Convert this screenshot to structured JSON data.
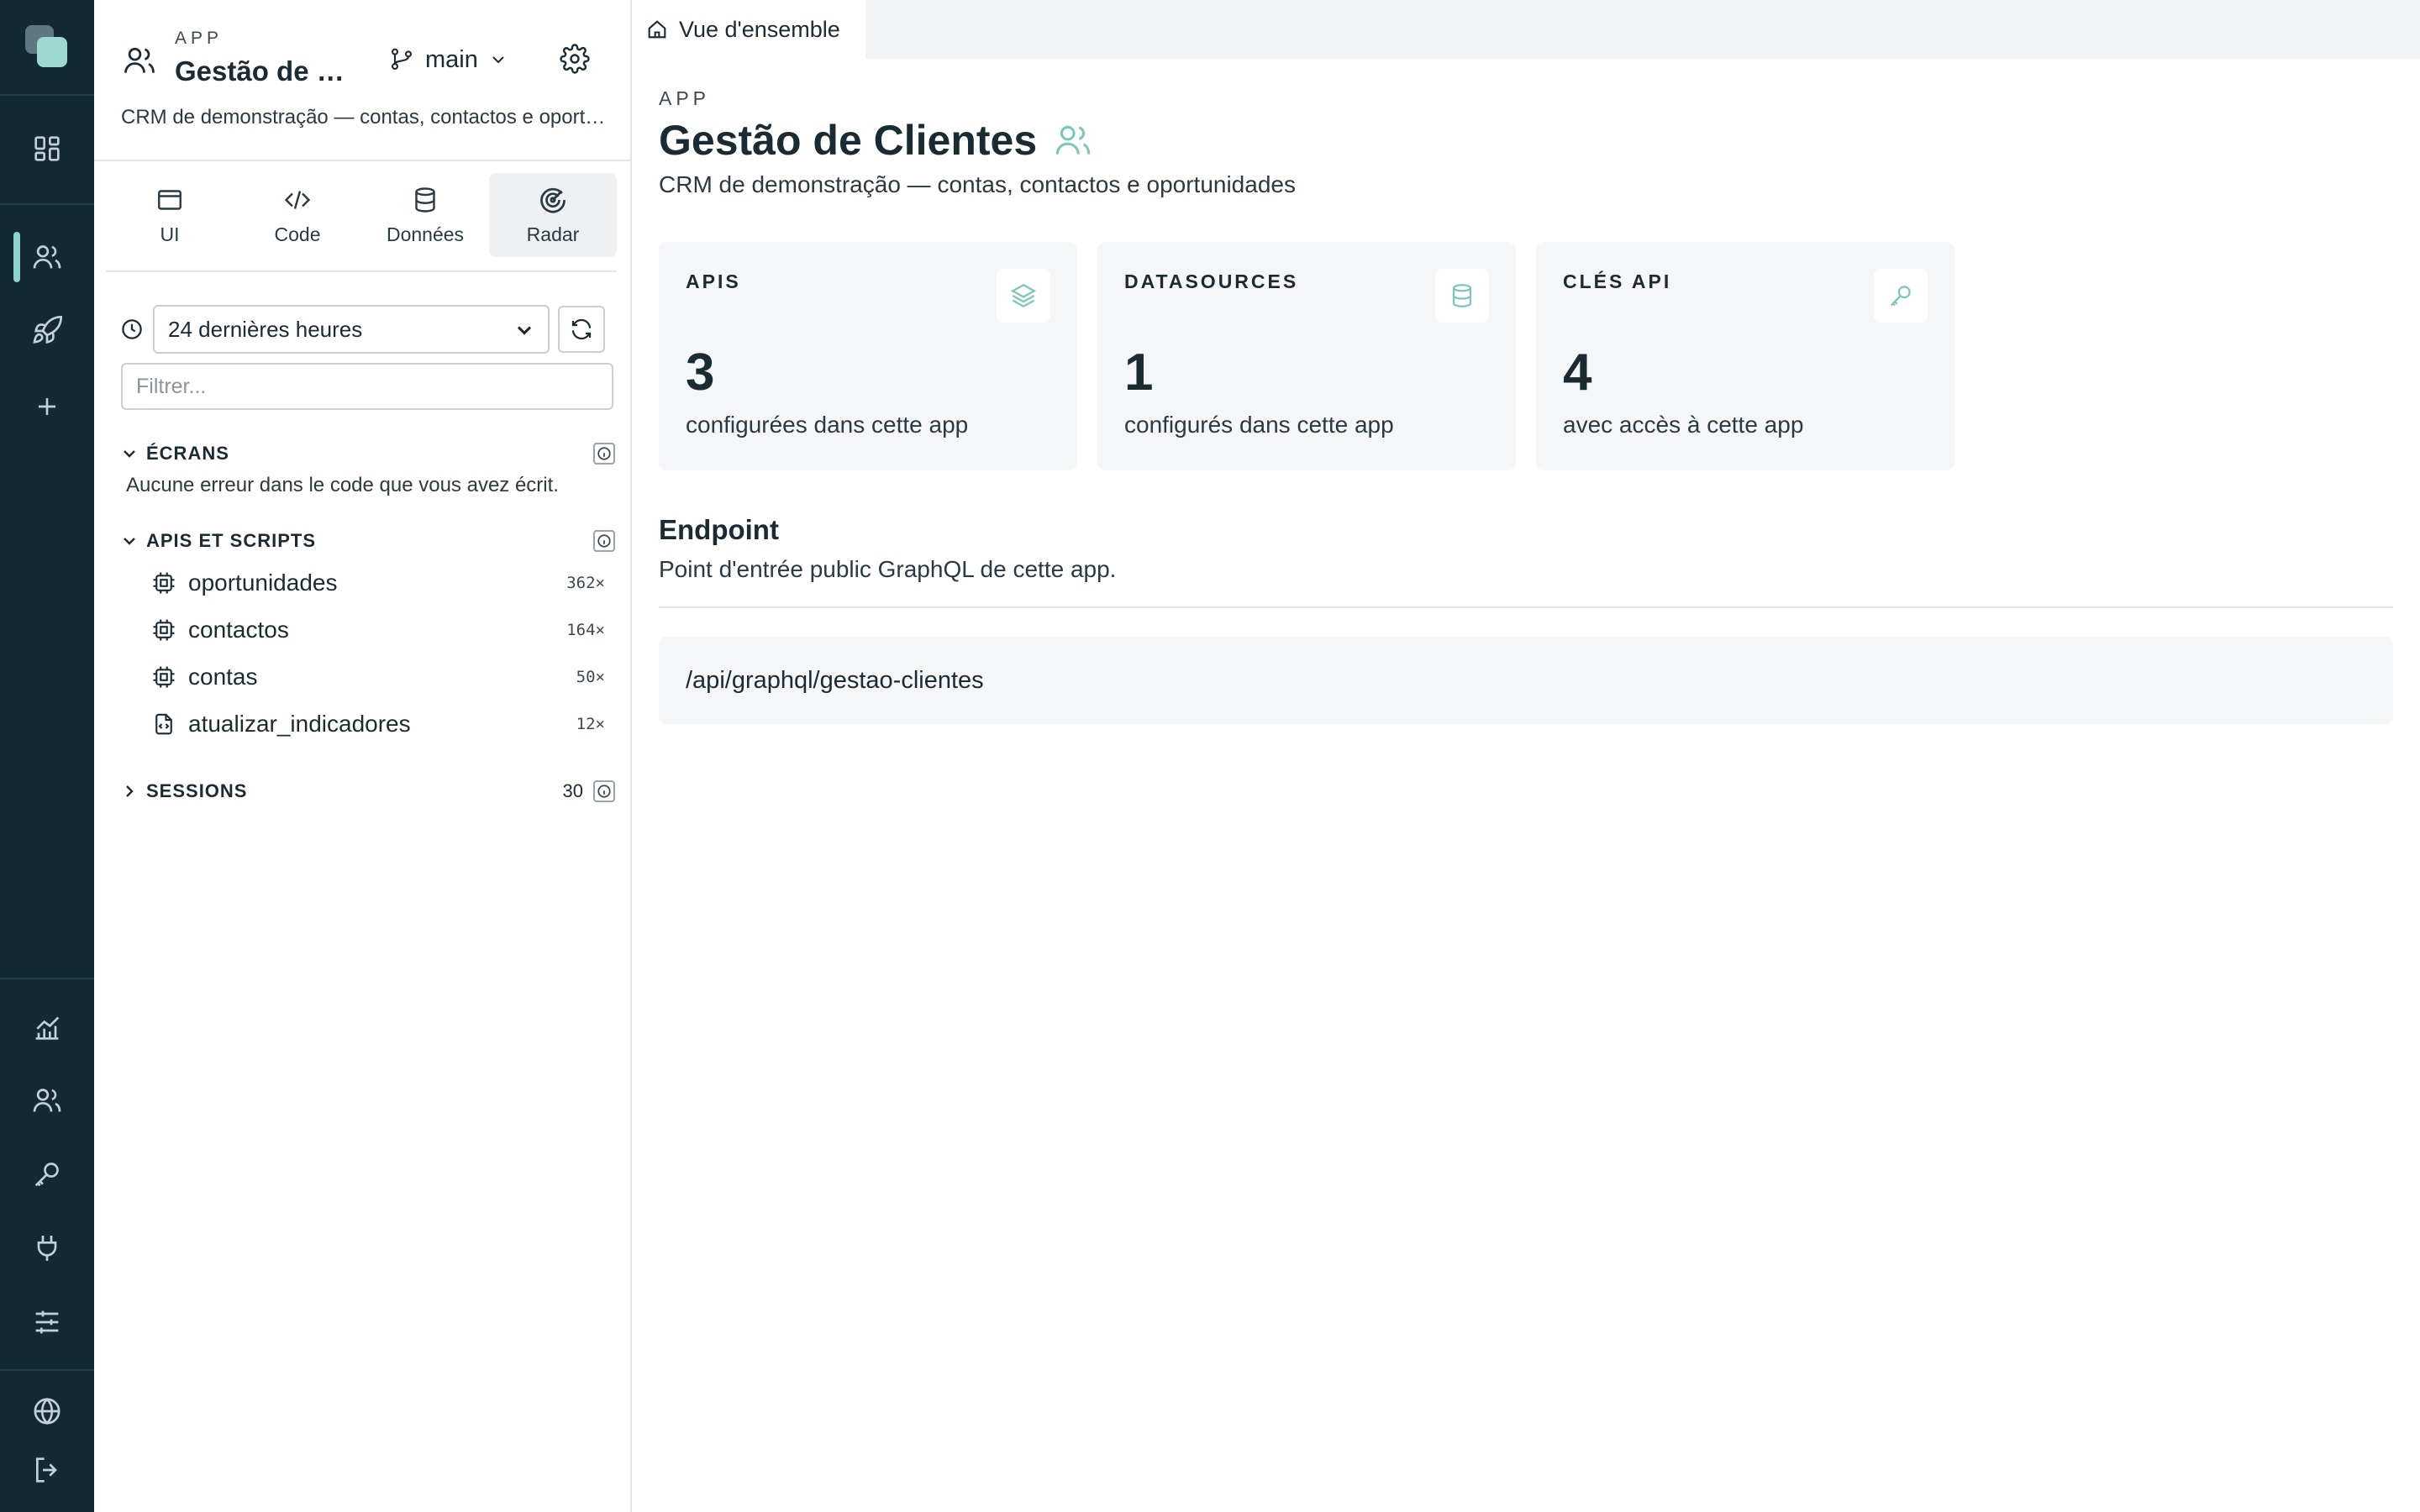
{
  "colors": {
    "rail_bg": "#132a33",
    "accent": "#7cc7ba",
    "card_bg": "#f5f6f7"
  },
  "app_panel": {
    "kicker": "APP",
    "title": "Gestão de Clientes",
    "branch": "main",
    "description": "CRM de demonstração — contas, contactos e oportunidades",
    "tabs": [
      {
        "label": "UI",
        "icon": "browser-window-icon"
      },
      {
        "label": "Code",
        "icon": "code-icon"
      },
      {
        "label": "Données",
        "icon": "database-icon"
      },
      {
        "label": "Radar",
        "icon": "radar-icon",
        "active": true
      }
    ],
    "time_range": "24 dernières heures",
    "filter_placeholder": "Filtrer...",
    "screens": {
      "title": "ÉCRANS",
      "note": "Aucune erreur dans le code que vous avez écrit."
    },
    "apis": {
      "title": "APIS ET SCRIPTS",
      "items": [
        {
          "name": "oportunidades",
          "count": "362×",
          "icon": "chip-icon"
        },
        {
          "name": "contactos",
          "count": "164×",
          "icon": "chip-icon"
        },
        {
          "name": "contas",
          "count": "50×",
          "icon": "chip-icon"
        },
        {
          "name": "atualizar_indicadores",
          "count": "12×",
          "icon": "script-file-icon"
        }
      ]
    },
    "sessions": {
      "title": "SESSIONS",
      "count": "30"
    }
  },
  "main": {
    "tab_label": "Vue d'ensemble",
    "kicker": "APP",
    "title": "Gestão de Clientes",
    "subtitle": "CRM de demonstração — contas, contactos e oportunidades",
    "cards": [
      {
        "label": "APIS",
        "value": "3",
        "caption": "configurées dans cette app",
        "icon": "layers-icon"
      },
      {
        "label": "DATASOURCES",
        "value": "1",
        "caption": "configurés dans cette app",
        "icon": "database-icon"
      },
      {
        "label": "CLÉS API",
        "value": "4",
        "caption": "avec accès à cette app",
        "icon": "key-icon"
      }
    ],
    "endpoint": {
      "title": "Endpoint",
      "subtitle": "Point d'entrée public GraphQL de cette app.",
      "path": "/api/graphql/gestao-clientes"
    }
  }
}
